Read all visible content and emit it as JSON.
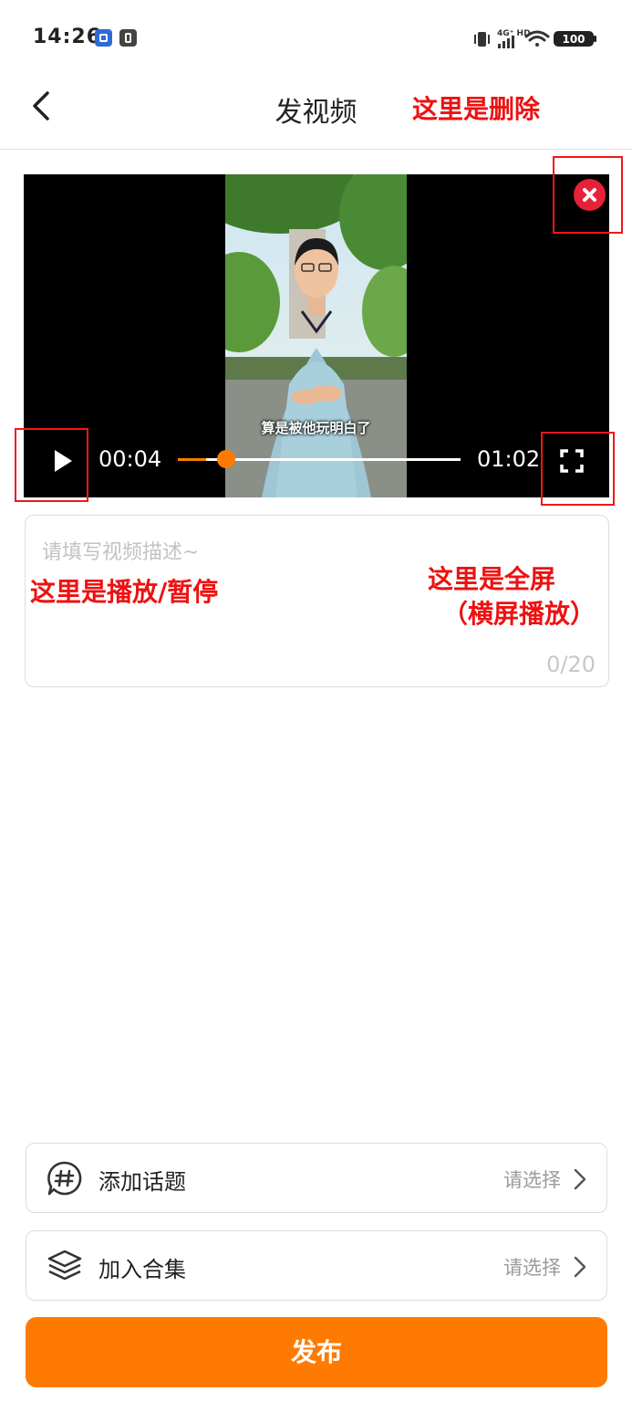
{
  "status_bar": {
    "time": "14:26",
    "signal_label": "4G⁺ HD",
    "battery": "100"
  },
  "header": {
    "title": "发视频",
    "annotation": "这里是删除"
  },
  "video": {
    "subtitle": "算是被他玩明白了",
    "current_time": "00:04",
    "duration": "01:02",
    "progress": 0.1
  },
  "annotations": {
    "play_pause": "这里是播放/暂停",
    "fullscreen_line1": "这里是全屏",
    "fullscreen_line2": "（横屏播放）"
  },
  "description": {
    "placeholder": "请填写视频描述~",
    "counter": "0/20"
  },
  "options": [
    {
      "label": "添加话题",
      "value": "请选择",
      "icon": "hashtag-icon"
    },
    {
      "label": "加入合集",
      "value": "请选择",
      "icon": "layers-icon"
    }
  ],
  "publish_label": "发布",
  "colors": {
    "accent": "#ff7a00",
    "annotation": "#ee1111",
    "delete": "#e8213a"
  }
}
